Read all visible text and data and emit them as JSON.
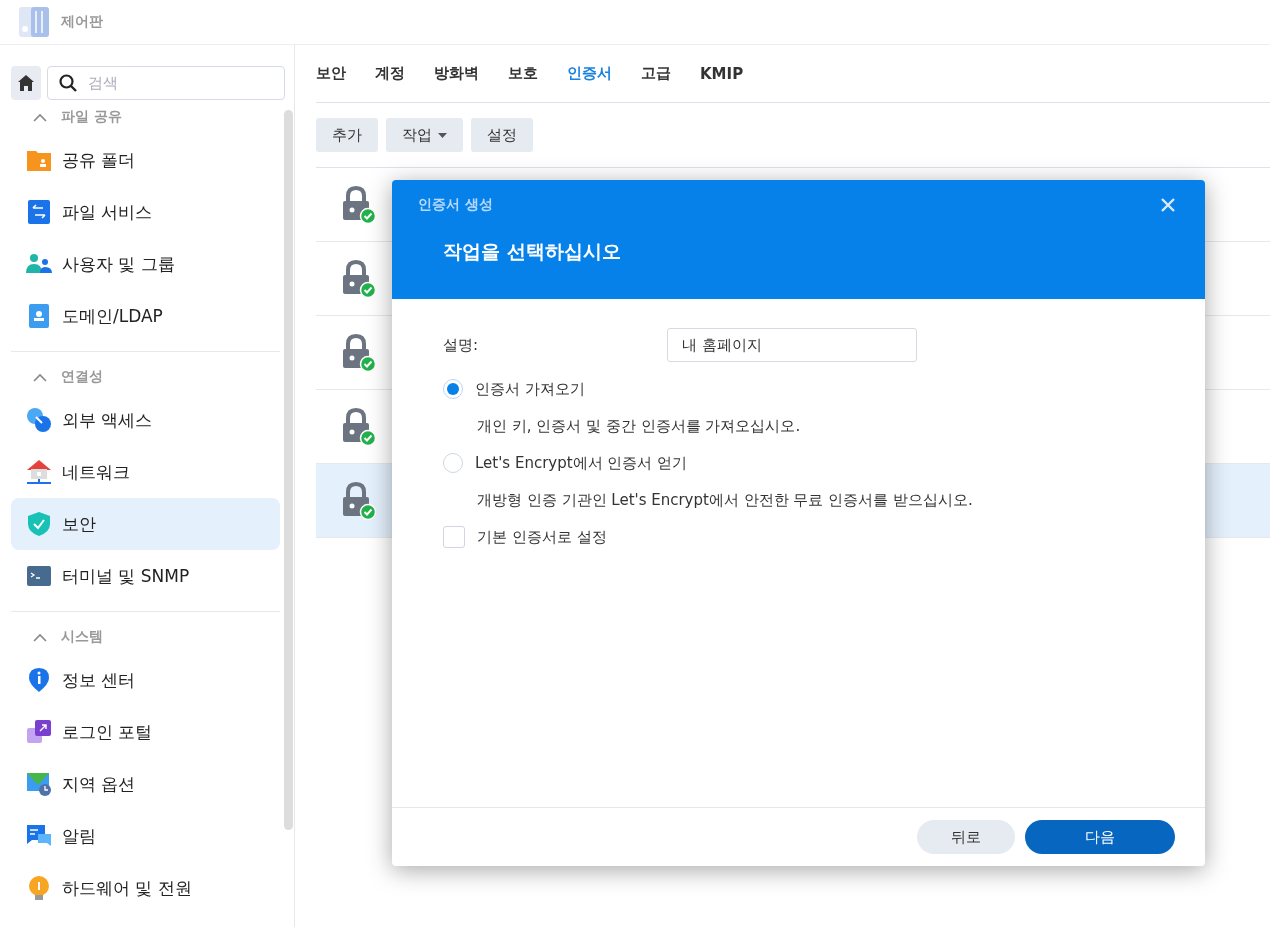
{
  "window": {
    "title": "제어판"
  },
  "sidebar": {
    "search": {
      "placeholder": "검색"
    },
    "sections": [
      {
        "title": "파일 공유",
        "expanded": true,
        "items": [
          {
            "label": "공유 폴더",
            "selected": false
          },
          {
            "label": "파일 서비스",
            "selected": false
          },
          {
            "label": "사용자 및 그룹",
            "selected": false
          },
          {
            "label": "도메인/LDAP",
            "selected": false
          }
        ]
      },
      {
        "title": "연결성",
        "expanded": true,
        "items": [
          {
            "label": "외부 액세스",
            "selected": false
          },
          {
            "label": "네트워크",
            "selected": false
          },
          {
            "label": "보안",
            "selected": true
          },
          {
            "label": "터미널 및 SNMP",
            "selected": false
          }
        ]
      },
      {
        "title": "시스템",
        "expanded": true,
        "items": [
          {
            "label": "정보 센터",
            "selected": false
          },
          {
            "label": "로그인 포털",
            "selected": false
          },
          {
            "label": "지역 옵션",
            "selected": false
          },
          {
            "label": "알림",
            "selected": false
          },
          {
            "label": "하드웨어 및 전원",
            "selected": false
          }
        ]
      }
    ]
  },
  "tabs": [
    {
      "label": "보안",
      "selected": false
    },
    {
      "label": "계정",
      "selected": false
    },
    {
      "label": "방화벽",
      "selected": false
    },
    {
      "label": "보호",
      "selected": false
    },
    {
      "label": "인증서",
      "selected": true
    },
    {
      "label": "고급",
      "selected": false
    },
    {
      "label": "KMIP",
      "selected": false
    }
  ],
  "toolbar": [
    {
      "label": "추가",
      "kind": "button"
    },
    {
      "label": "작업",
      "kind": "dropdown"
    },
    {
      "label": "설정",
      "kind": "button"
    }
  ],
  "certificates": [
    {
      "selected": false
    },
    {
      "selected": false
    },
    {
      "selected": false
    },
    {
      "selected": false
    },
    {
      "selected": true
    }
  ],
  "dialog": {
    "subtitle": "인증서 생성",
    "title": "작업을 선택하십시오",
    "description": {
      "label": "설명:",
      "value": "내 홈페이지"
    },
    "options": [
      {
        "kind": "radio",
        "label": "인증서 가져오기",
        "hint": "개인 키, 인증서 및 중간 인증서를 가져오십시오.",
        "selected": true
      },
      {
        "kind": "radio",
        "label": "Let's Encrypt에서 인증서 얻기",
        "hint": "개방형 인증 기관인 Let's Encrypt에서 안전한 무료 인증서를 받으십시오.",
        "selected": false
      },
      {
        "kind": "checkbox",
        "label": "기본 인증서로 설정",
        "checked": false
      }
    ],
    "buttons": [
      {
        "label": "뒤로",
        "primary": false
      },
      {
        "label": "다음",
        "primary": true
      }
    ]
  }
}
